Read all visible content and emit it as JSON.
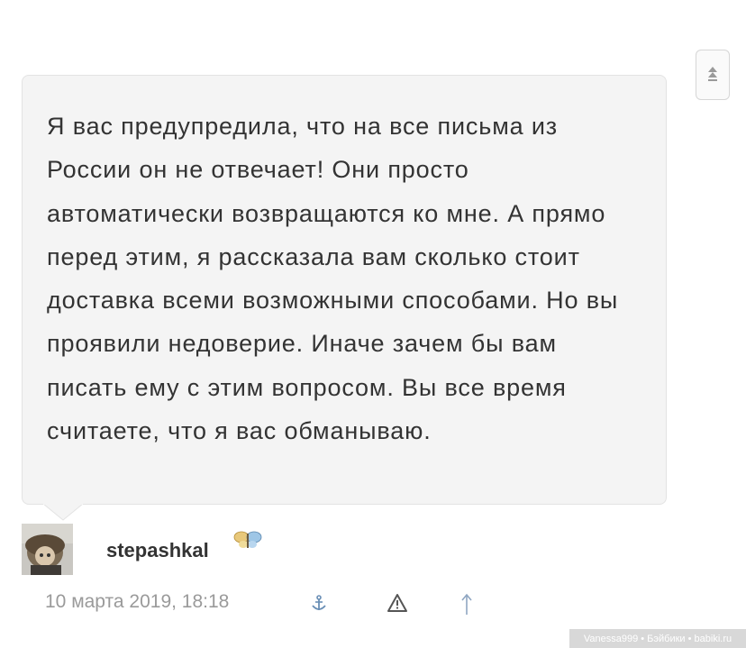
{
  "comment": {
    "text": "Я вас предупредила, что на все письма из России он не отвечает! Они просто автоматически возвращаются ко мне. А прямо перед этим, я рассказала вам сколько стоит доставка всеми возможными способами. Но вы проявили недоверие. Иначе зачем бы вам писать ему с этим вопросом. Вы все время считаете, что я вас обманываю."
  },
  "author": {
    "username": "stepashkal",
    "badge_icon": "butterfly-icon"
  },
  "meta": {
    "date": "10 марта 2019, 18:18"
  },
  "actions": {
    "anchor_icon": "anchor-icon",
    "report_icon": "warning-icon",
    "reply_icon": "arrow-up-icon",
    "side_icon": "scroll-top-icon"
  },
  "watermark": {
    "text": "Vanessa999 • Бэйбики • babiki.ru"
  },
  "colors": {
    "bubble_bg": "#f4f4f4",
    "text": "#333333",
    "meta": "#9a9a9a",
    "icon_blue": "#6a8fb6"
  }
}
